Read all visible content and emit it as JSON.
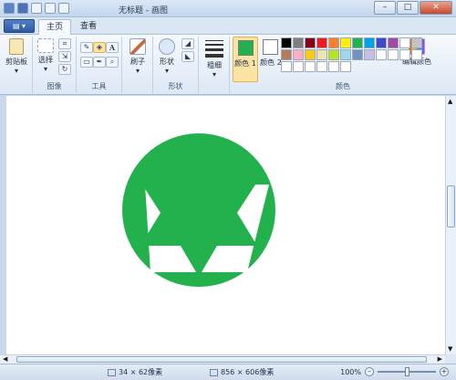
{
  "window": {
    "title": "无标题 - 画图",
    "controls": {
      "minimize": "–",
      "maximize": "□",
      "close": "✕"
    }
  },
  "tabs": [
    {
      "label": "主页",
      "active": true
    },
    {
      "label": "查看",
      "active": false
    }
  ],
  "app_menu_label": "▤ ▾",
  "ribbon": {
    "clipboard": {
      "paste_label": "剪贴板",
      "group": ""
    },
    "image": {
      "select_label": "选择",
      "group": "图像"
    },
    "tools": {
      "text_glyph": "A",
      "group": "工具"
    },
    "brushes": {
      "label": "刷子"
    },
    "shapes": {
      "label": "形状",
      "group": "形状"
    },
    "size": {
      "label": "粗细"
    },
    "color1": {
      "label": "颜色 1",
      "value": "#22b14c"
    },
    "color2": {
      "label": "颜色 2",
      "value": "#ffffff"
    },
    "colors_group": "颜色",
    "edit_colors_label": "编辑颜色",
    "palette": [
      "#000000",
      "#7f7f7f",
      "#880015",
      "#ed1c24",
      "#ff7f27",
      "#fff200",
      "#22b14c",
      "#00a2e8",
      "#3f48cc",
      "#a349a4",
      "#ffffff",
      "#c3c3c3",
      "#b97a57",
      "#ffaec9",
      "#ffc90e",
      "#efe4b0",
      "#b5e61d",
      "#99d9ea",
      "#7092be",
      "#c8bfe7",
      "#ffffff",
      "#ffffff",
      "#ffffff",
      "#ffffff",
      "#ffffff",
      "#ffffff",
      "#ffffff",
      "#ffffff",
      "#ffffff",
      "#ffffff"
    ]
  },
  "drawing": {
    "fill_color": "#22b14c",
    "background": "#ffffff"
  },
  "statusbar": {
    "cursor_pos": "34 × 62像素",
    "canvas_size": "856 × 606像素",
    "zoom": "100%"
  }
}
